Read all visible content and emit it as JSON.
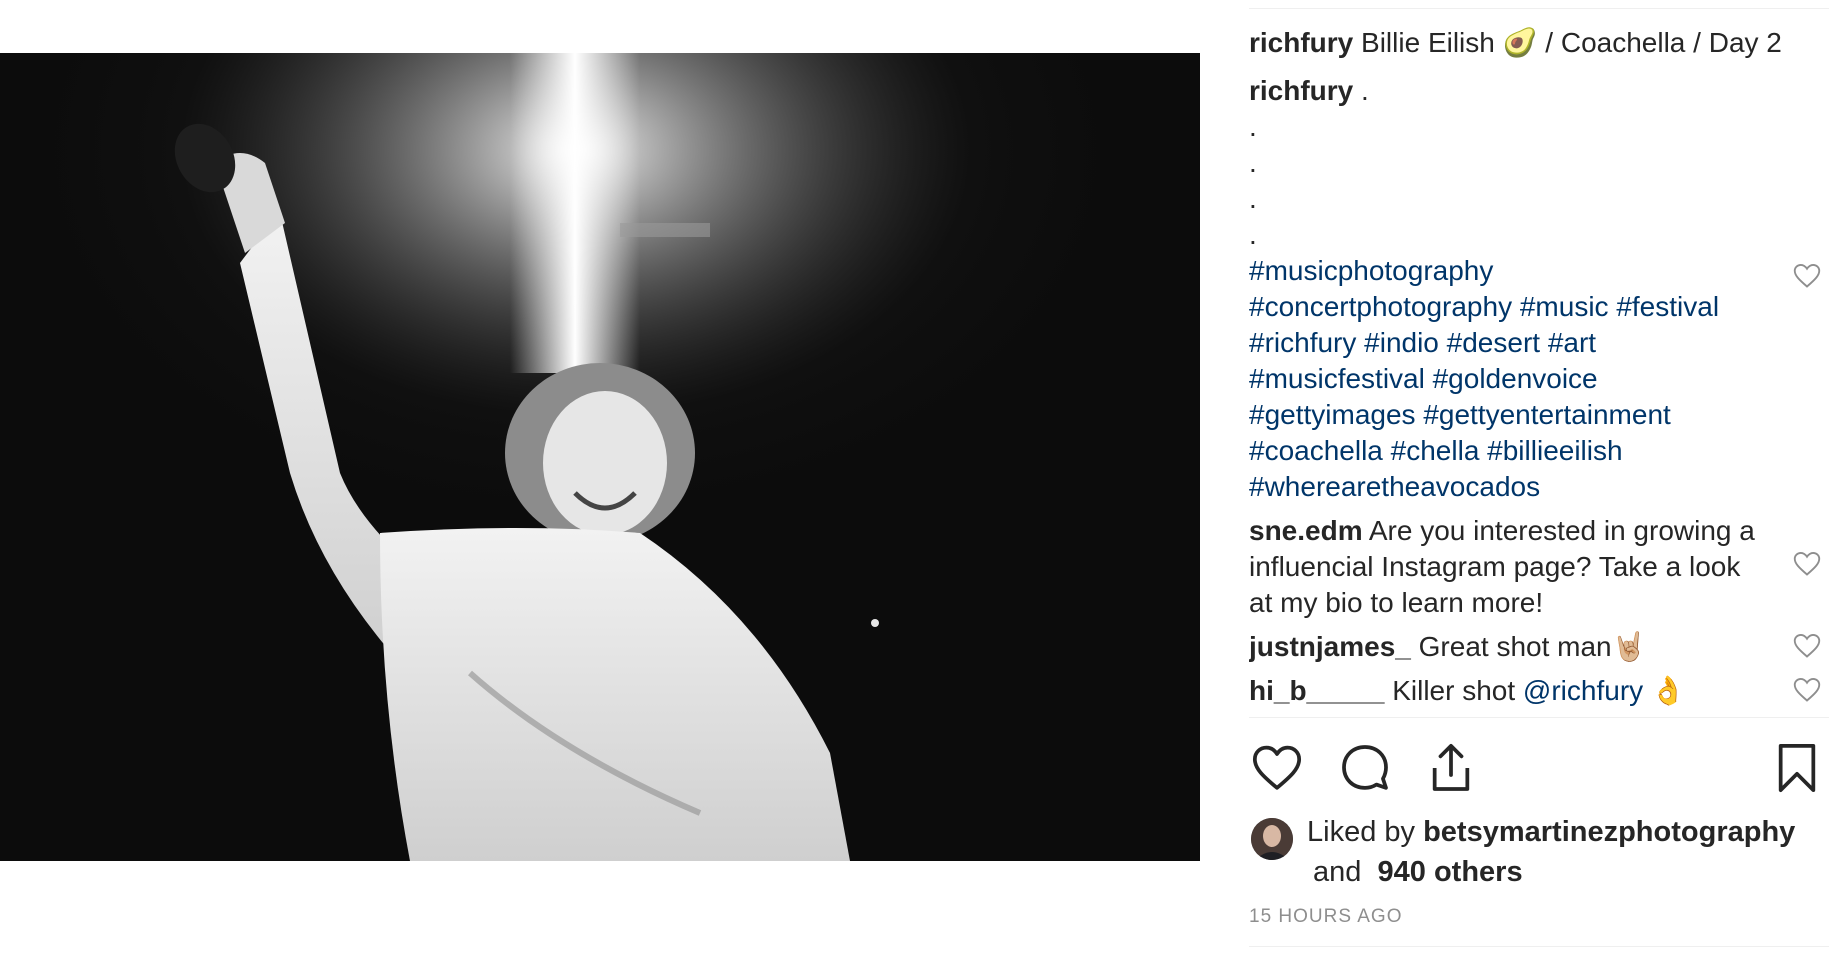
{
  "post": {
    "image_alt": "Black and white concert photo of performer with raised arm holding microphone",
    "caption": {
      "username": "richfury",
      "text_before_emoji": "Billie Eilish",
      "emoji": "🥑",
      "text_after_emoji": "/ Coachella / Day 2"
    },
    "first_comment": {
      "username": "richfury",
      "text": ".",
      "dots": [
        ".",
        ".",
        ".",
        "."
      ],
      "hashtags": [
        "#musicphotography",
        "#concertphotography #music #festival",
        "#richfury #indio #desert #art",
        "#musicfestival #goldenvoice",
        "#gettyimages #gettyentertainment",
        "#coachella #chella #billieeilish",
        "#wherearetheavocados"
      ]
    },
    "comments": [
      {
        "username": "sne.edm",
        "text": "Are you interested in growing a influencial Instagram page? Take a look at my bio to learn more!"
      },
      {
        "username": "justnjames_",
        "text": "Great shot man",
        "emoji": "🤘🏼"
      },
      {
        "username": "hi_b_____",
        "text": "Killer shot",
        "mention": "@richfury",
        "emoji": "👌"
      }
    ],
    "likes": {
      "prefix": "Liked by",
      "user": "betsymartinezphotography",
      "and": "and",
      "others": "940 others"
    },
    "timestamp": "15 HOURS AGO"
  },
  "colors": {
    "hashtag": "#003569",
    "text": "#262626",
    "meta": "#8e8e8e"
  },
  "icons": [
    "heart-icon",
    "comment-icon",
    "share-icon",
    "bookmark-icon"
  ]
}
